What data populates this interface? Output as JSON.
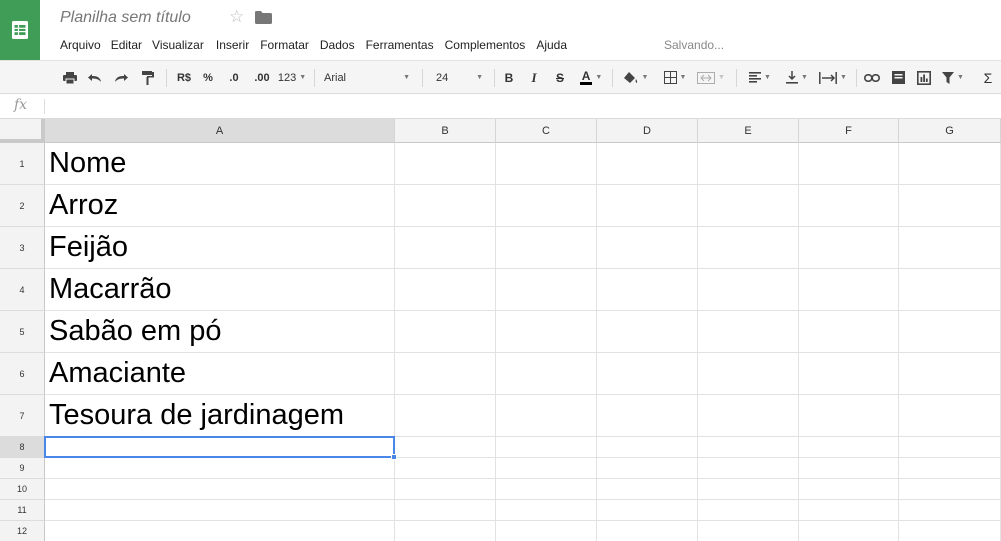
{
  "app": {
    "logo": "sheets-icon",
    "document_title": "Planilha sem título",
    "save_status": "Salvando..."
  },
  "menu": [
    "Arquivo",
    "Editar",
    "Visualizar",
    "Inserir",
    "Formatar",
    "Dados",
    "Ferramentas",
    "Complementos",
    "Ajuda"
  ],
  "toolbar": {
    "currency_label": "R$",
    "percent_label": "%",
    "decrease_decimal_label": ".0",
    "increase_decimal_label": ".00",
    "more_formats_label": "123",
    "font_family": "Arial",
    "font_size": "24",
    "bold_label": "B",
    "italic_label": "I",
    "strikethrough_label": "S",
    "text_color_label": "A",
    "functions_label": "Σ"
  },
  "formula_bar": {
    "fx_label": "fx",
    "value": ""
  },
  "grid": {
    "columns": [
      "A",
      "B",
      "C",
      "D",
      "E",
      "F",
      "G"
    ],
    "rows": [
      {
        "number": "1",
        "a": "Nome"
      },
      {
        "number": "2",
        "a": "Arroz"
      },
      {
        "number": "3",
        "a": "Feijão"
      },
      {
        "number": "4",
        "a": "Macarrão"
      },
      {
        "number": "5",
        "a": "Sabão em pó"
      },
      {
        "number": "6",
        "a": "Amaciante"
      },
      {
        "number": "7",
        "a": "Tesoura de jardinagem"
      },
      {
        "number": "8",
        "a": ""
      },
      {
        "number": "9",
        "a": ""
      },
      {
        "number": "10",
        "a": ""
      },
      {
        "number": "11",
        "a": ""
      },
      {
        "number": "12",
        "a": ""
      }
    ],
    "selected_column": "A",
    "selected_row": "8"
  },
  "colors": {
    "brand": "#3f9d58",
    "selection": "#4a86e8"
  }
}
